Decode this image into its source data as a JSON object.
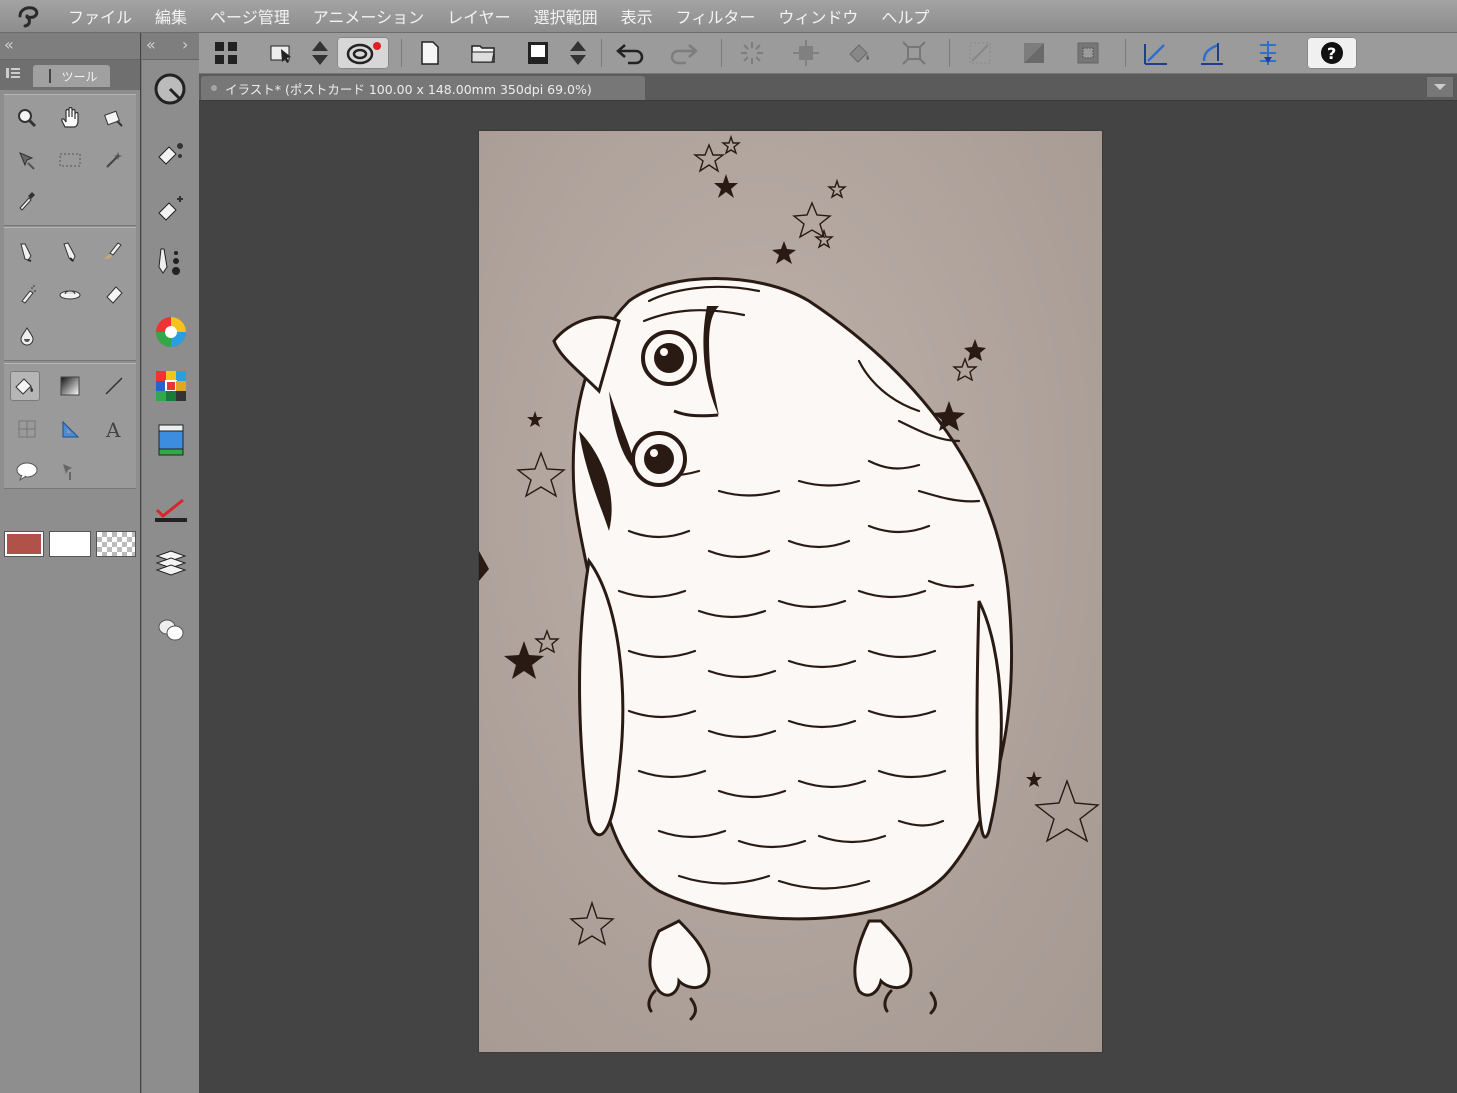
{
  "app": {
    "name": "CLIP STUDIO PAINT"
  },
  "menu": {
    "items": [
      "ファイル",
      "編集",
      "ページ管理",
      "アニメーション",
      "レイヤー",
      "選択範囲",
      "表示",
      "フィルター",
      "ウィンドウ",
      "ヘルプ"
    ]
  },
  "tool_panel": {
    "tab_label": "ツール"
  },
  "tools": {
    "icons": [
      "zoom-tool-icon",
      "hand-tool-icon",
      "rotate-view-icon",
      "move-tool-icon",
      "rect-selection-icon",
      "auto-select-icon",
      "eyedropper-icon",
      "pen-tool-icon",
      "pencil-tool-icon",
      "brush-tool-icon",
      "airbrush-tool-icon",
      "decoration-tool-icon",
      "eraser-tool-icon",
      "blend-tool-icon",
      "fill-tool-icon",
      "gradient-tool-icon",
      "line-tool-icon",
      "frame-tool-icon",
      "ruler-tool-icon",
      "text-tool-icon",
      "balloon-tool-icon",
      "correct-line-tool-icon"
    ],
    "active": "fill-tool-icon"
  },
  "colors": {
    "main_color": "#b0524a",
    "sub_color": "#ffffff",
    "transparent_label": "transparent"
  },
  "icon_strip": {
    "icons": [
      "navigator-icon",
      "sub-tool-icon",
      "tool-property-icon",
      "brush-size-icon",
      "color-wheel-icon",
      "color-set-icon",
      "material-icon",
      "layer-property-icon",
      "layer-icon",
      "timeline-icon"
    ]
  },
  "toolbar": {
    "icons": [
      "workspace-icon",
      "clip-studio-icon",
      "scroll-icon",
      "clip-studio-cloud-icon",
      "new-file-icon",
      "open-file-icon",
      "save-icon",
      "scroll-2-icon",
      "undo-icon",
      "redo-icon",
      "clear-selection-icon",
      "transform-icon",
      "fill-selection-icon",
      "expand-selection-icon",
      "clear-icon",
      "clear-outside-icon",
      "invert-selection-icon",
      "snap-ruler-icon",
      "snap-special-ruler-icon",
      "snap-grid-icon",
      "help-icon"
    ]
  },
  "document": {
    "tab_label": "イラスト* (ポストカード 100.00 x 148.00mm 350dpi 69.0%)"
  }
}
